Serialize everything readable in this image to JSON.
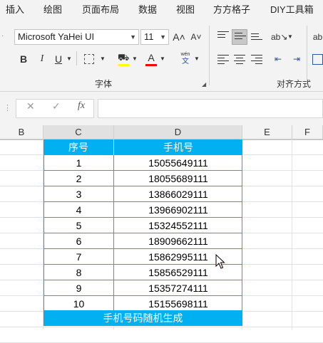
{
  "ribbon_tabs": [
    "插入",
    "绘图",
    "页面布局",
    "数据",
    "视图",
    "方方格子",
    "DIY工具箱"
  ],
  "font": {
    "name": "Microsoft YaHei UI",
    "size": "11",
    "grow_label": "A˄",
    "shrink_label": "A˅",
    "bold": "B",
    "italic": "I",
    "underline": "U",
    "font_color_label": "A",
    "phonetic_top": "wén",
    "phonetic_bottom": "文",
    "group_label": "字体",
    "fill_color": "#ffff00",
    "font_color": "#ff0000"
  },
  "alignment": {
    "group_label": "对齐方式",
    "orientation": "ab"
  },
  "formula_bar": {
    "cancel": "✕",
    "enter": "✓",
    "fx": "fx",
    "value": ""
  },
  "columns": [
    "B",
    "C",
    "D",
    "E",
    "F"
  ],
  "table": {
    "headers": [
      "序号",
      "手机号"
    ],
    "rows": [
      [
        "1",
        "15055649111"
      ],
      [
        "2",
        "18055689111"
      ],
      [
        "3",
        "13866029111"
      ],
      [
        "4",
        "13966902111"
      ],
      [
        "5",
        "15324552111"
      ],
      [
        "6",
        "18909662111"
      ],
      [
        "7",
        "15862995111"
      ],
      [
        "8",
        "15856529111"
      ],
      [
        "9",
        "15357274111"
      ],
      [
        "10",
        "15155698111"
      ]
    ],
    "footer": "手机号码随机生成",
    "accent_color": "#00b0f0"
  }
}
